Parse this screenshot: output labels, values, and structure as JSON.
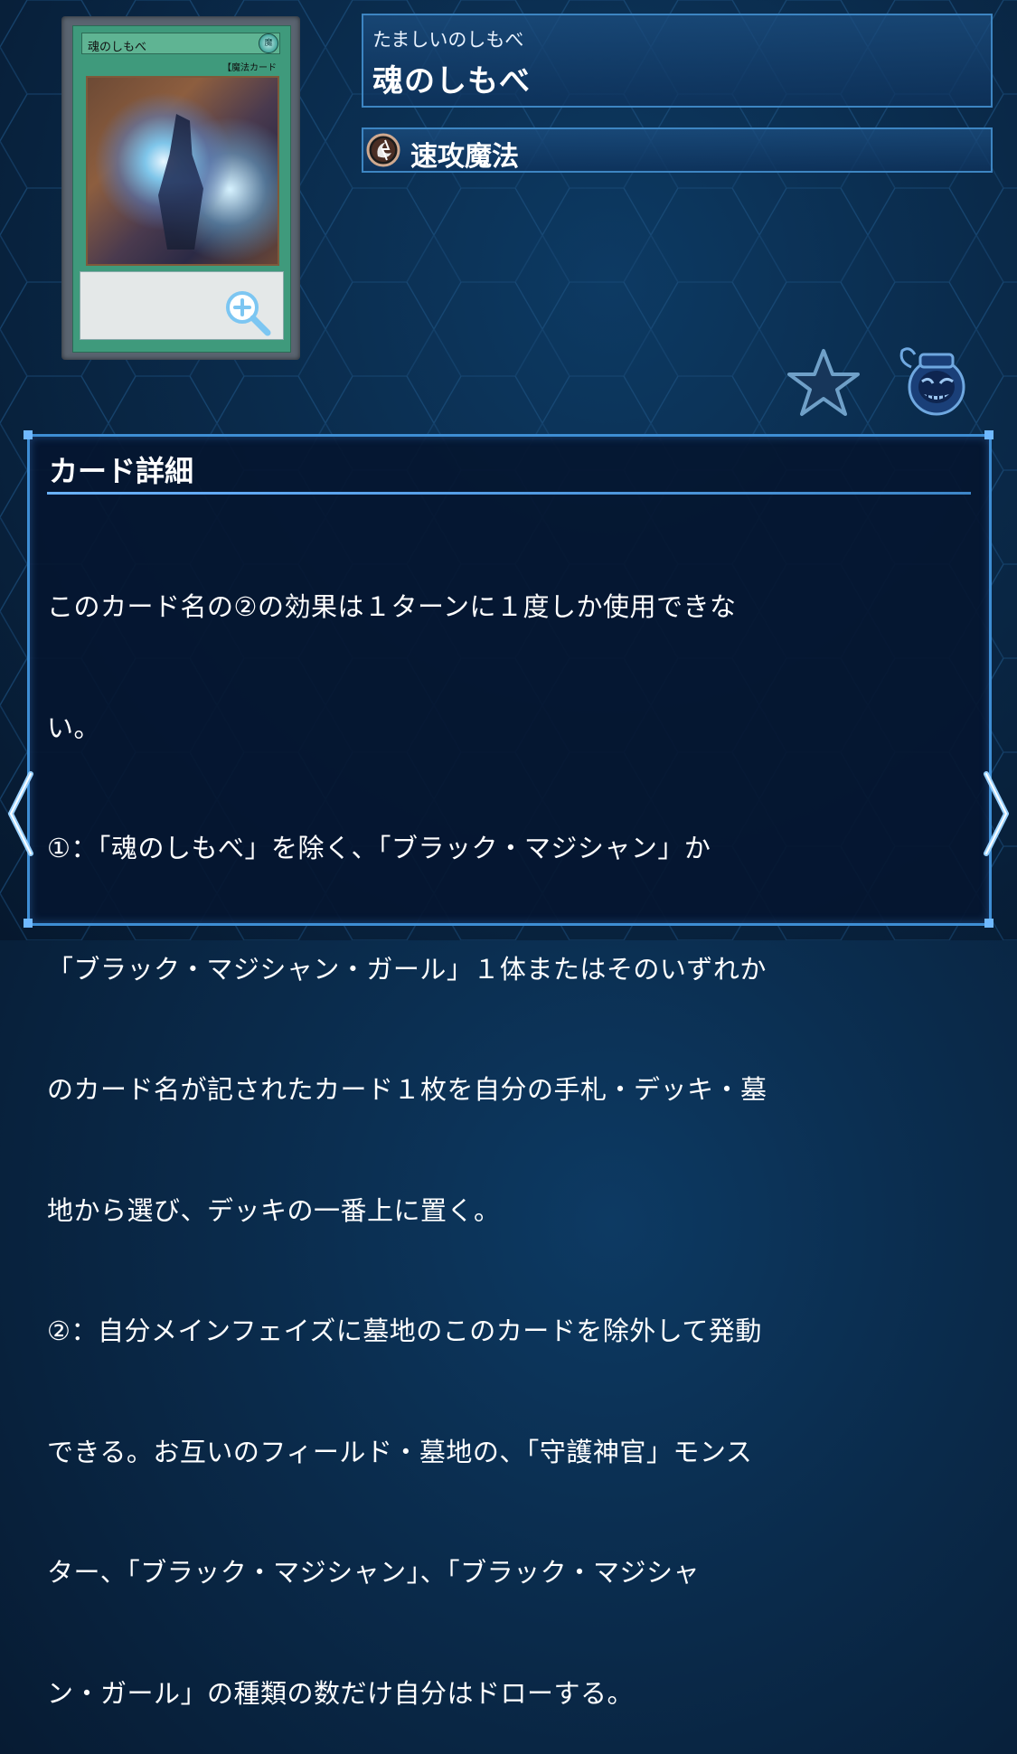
{
  "card": {
    "image_name_text": "魂のしもべ",
    "image_type_text": "【魔法カード",
    "image_attribute_text": "魔"
  },
  "header": {
    "ruby": "たましいのしもべ",
    "name": "魂のしもべ"
  },
  "type": {
    "label": "速攻魔法",
    "icon": "quick-play-spell-icon"
  },
  "actions": {
    "favorite_icon": "star-icon",
    "deck_icon": "pot-of-greed-icon",
    "zoom_icon": "zoom-in-icon"
  },
  "detail": {
    "title": "カード詳細",
    "lines": [
      "このカード名の②の効果は１ターンに１度しか使用できな",
      "い。",
      "①：「魂のしもべ」を除く、「ブラック・マジシャン」か",
      "「ブラック・マジシャン・ガール」１体またはそのいずれか",
      "のカード名が記されたカード１枚を自分の手札・デッキ・墓",
      "地から選び、デッキの一番上に置く。",
      "②：自分メインフェイズに墓地のこのカードを除外して発動",
      "できる。お互いのフィールド・墓地の、「守護神官」モンス",
      "ター、「ブラック・マジシャン」、「ブラック・マジシャ",
      "ン・ガール」の種類の数だけ自分はドローする。"
    ]
  },
  "nav": {
    "prev_icon": "chevron-left-icon",
    "next_icon": "chevron-right-icon"
  },
  "colors": {
    "panel_border": "#3e8ed4",
    "card_green": "#3f9a7c",
    "background": "#0a2a4a"
  }
}
